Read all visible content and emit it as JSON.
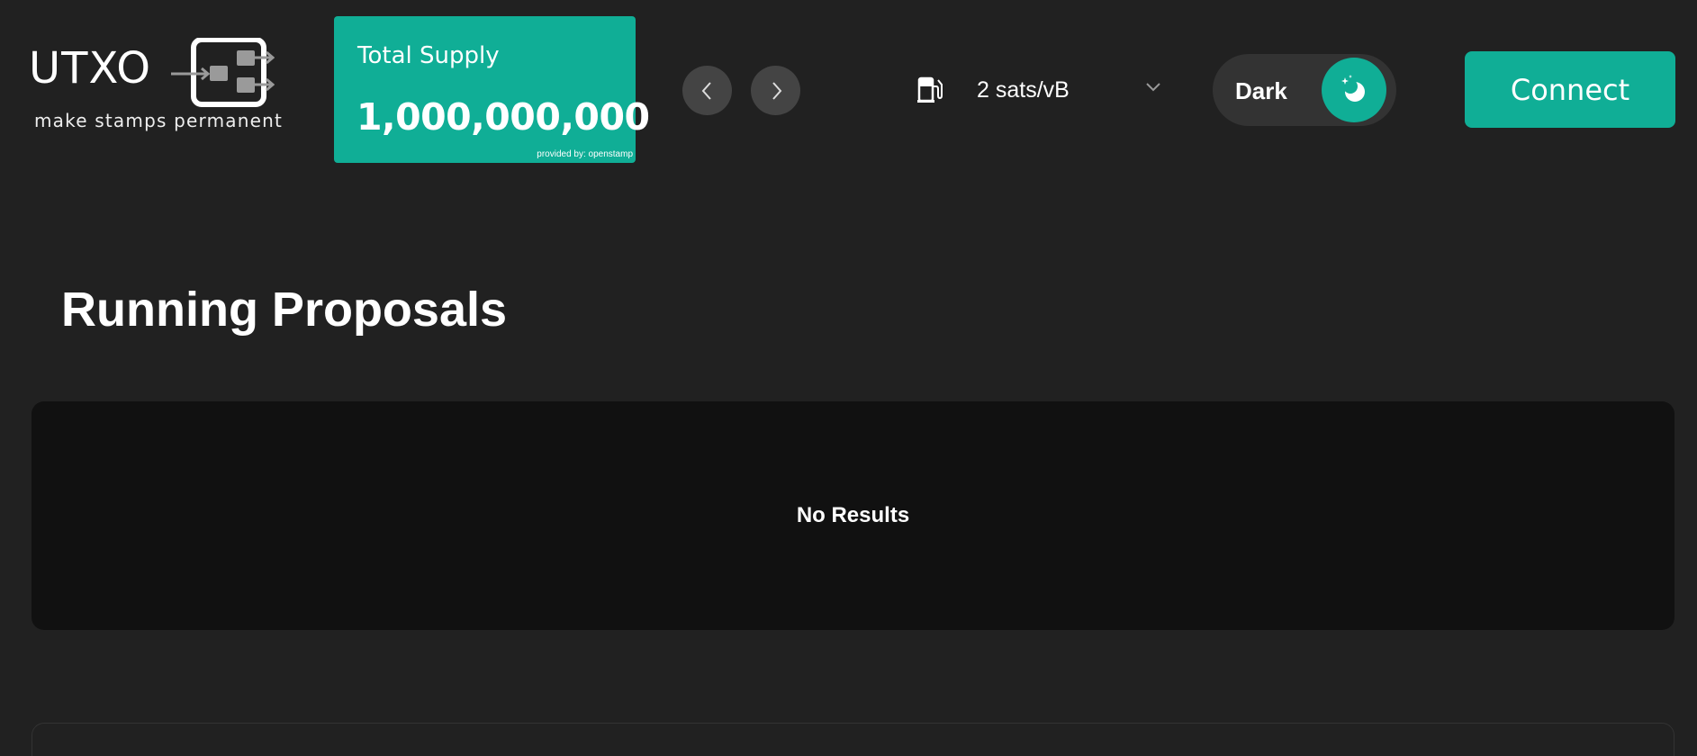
{
  "header": {
    "logo": {
      "wordmark": "UTXO",
      "tagline": "make stamps permanent",
      "icon": "stamp-arrows-icon"
    },
    "supply_card": {
      "title": "Total Supply",
      "value": "1,000,000,000",
      "source": "provided by: openstamp"
    },
    "nav": {
      "prev_icon": "chevron-left-icon",
      "next_icon": "chevron-right-icon"
    },
    "fee": {
      "icon": "fuel-pump-icon",
      "value": "2 sats/vB",
      "dropdown_icon": "chevron-down-icon"
    },
    "theme": {
      "label": "Dark",
      "icon": "moon-stars-icon"
    },
    "connect_label": "Connect"
  },
  "main": {
    "title": "Running Proposals",
    "empty_message": "No Results"
  },
  "colors": {
    "background": "#212121",
    "accent": "#10ae96",
    "panel": "#111111",
    "nav_button": "#444444",
    "toggle": "#333333"
  }
}
